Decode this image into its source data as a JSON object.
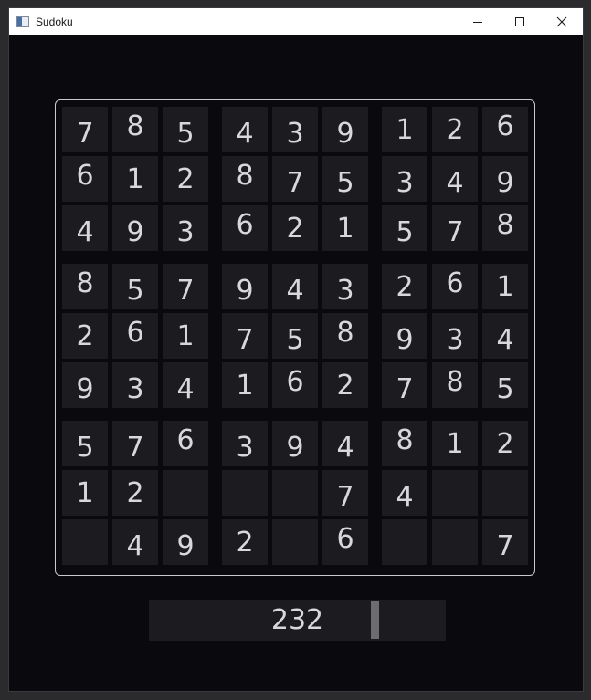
{
  "window": {
    "title": "Sudoku"
  },
  "board": {
    "rows": [
      [
        "7",
        "8",
        "5",
        "4",
        "3",
        "9",
        "1",
        "2",
        "6"
      ],
      [
        "6",
        "1",
        "2",
        "8",
        "7",
        "5",
        "3",
        "4",
        "9"
      ],
      [
        "4",
        "9",
        "3",
        "6",
        "2",
        "1",
        "5",
        "7",
        "8"
      ],
      [
        "8",
        "5",
        "7",
        "9",
        "4",
        "3",
        "2",
        "6",
        "1"
      ],
      [
        "2",
        "6",
        "1",
        "7",
        "5",
        "8",
        "9",
        "3",
        "4"
      ],
      [
        "9",
        "3",
        "4",
        "1",
        "6",
        "2",
        "7",
        "8",
        "5"
      ],
      [
        "5",
        "7",
        "6",
        "3",
        "9",
        "4",
        "8",
        "1",
        "2"
      ],
      [
        "1",
        "2",
        "",
        "",
        "",
        "7",
        "4",
        "",
        ""
      ],
      [
        "",
        "4",
        "9",
        "2",
        "",
        "6",
        "",
        "",
        "7"
      ]
    ]
  },
  "score": {
    "value": "232"
  },
  "colors": {
    "background": "#0a090d",
    "cell": "#1c1b20",
    "digit": "#d8d8dc",
    "board_border": "#c9c9cf"
  }
}
